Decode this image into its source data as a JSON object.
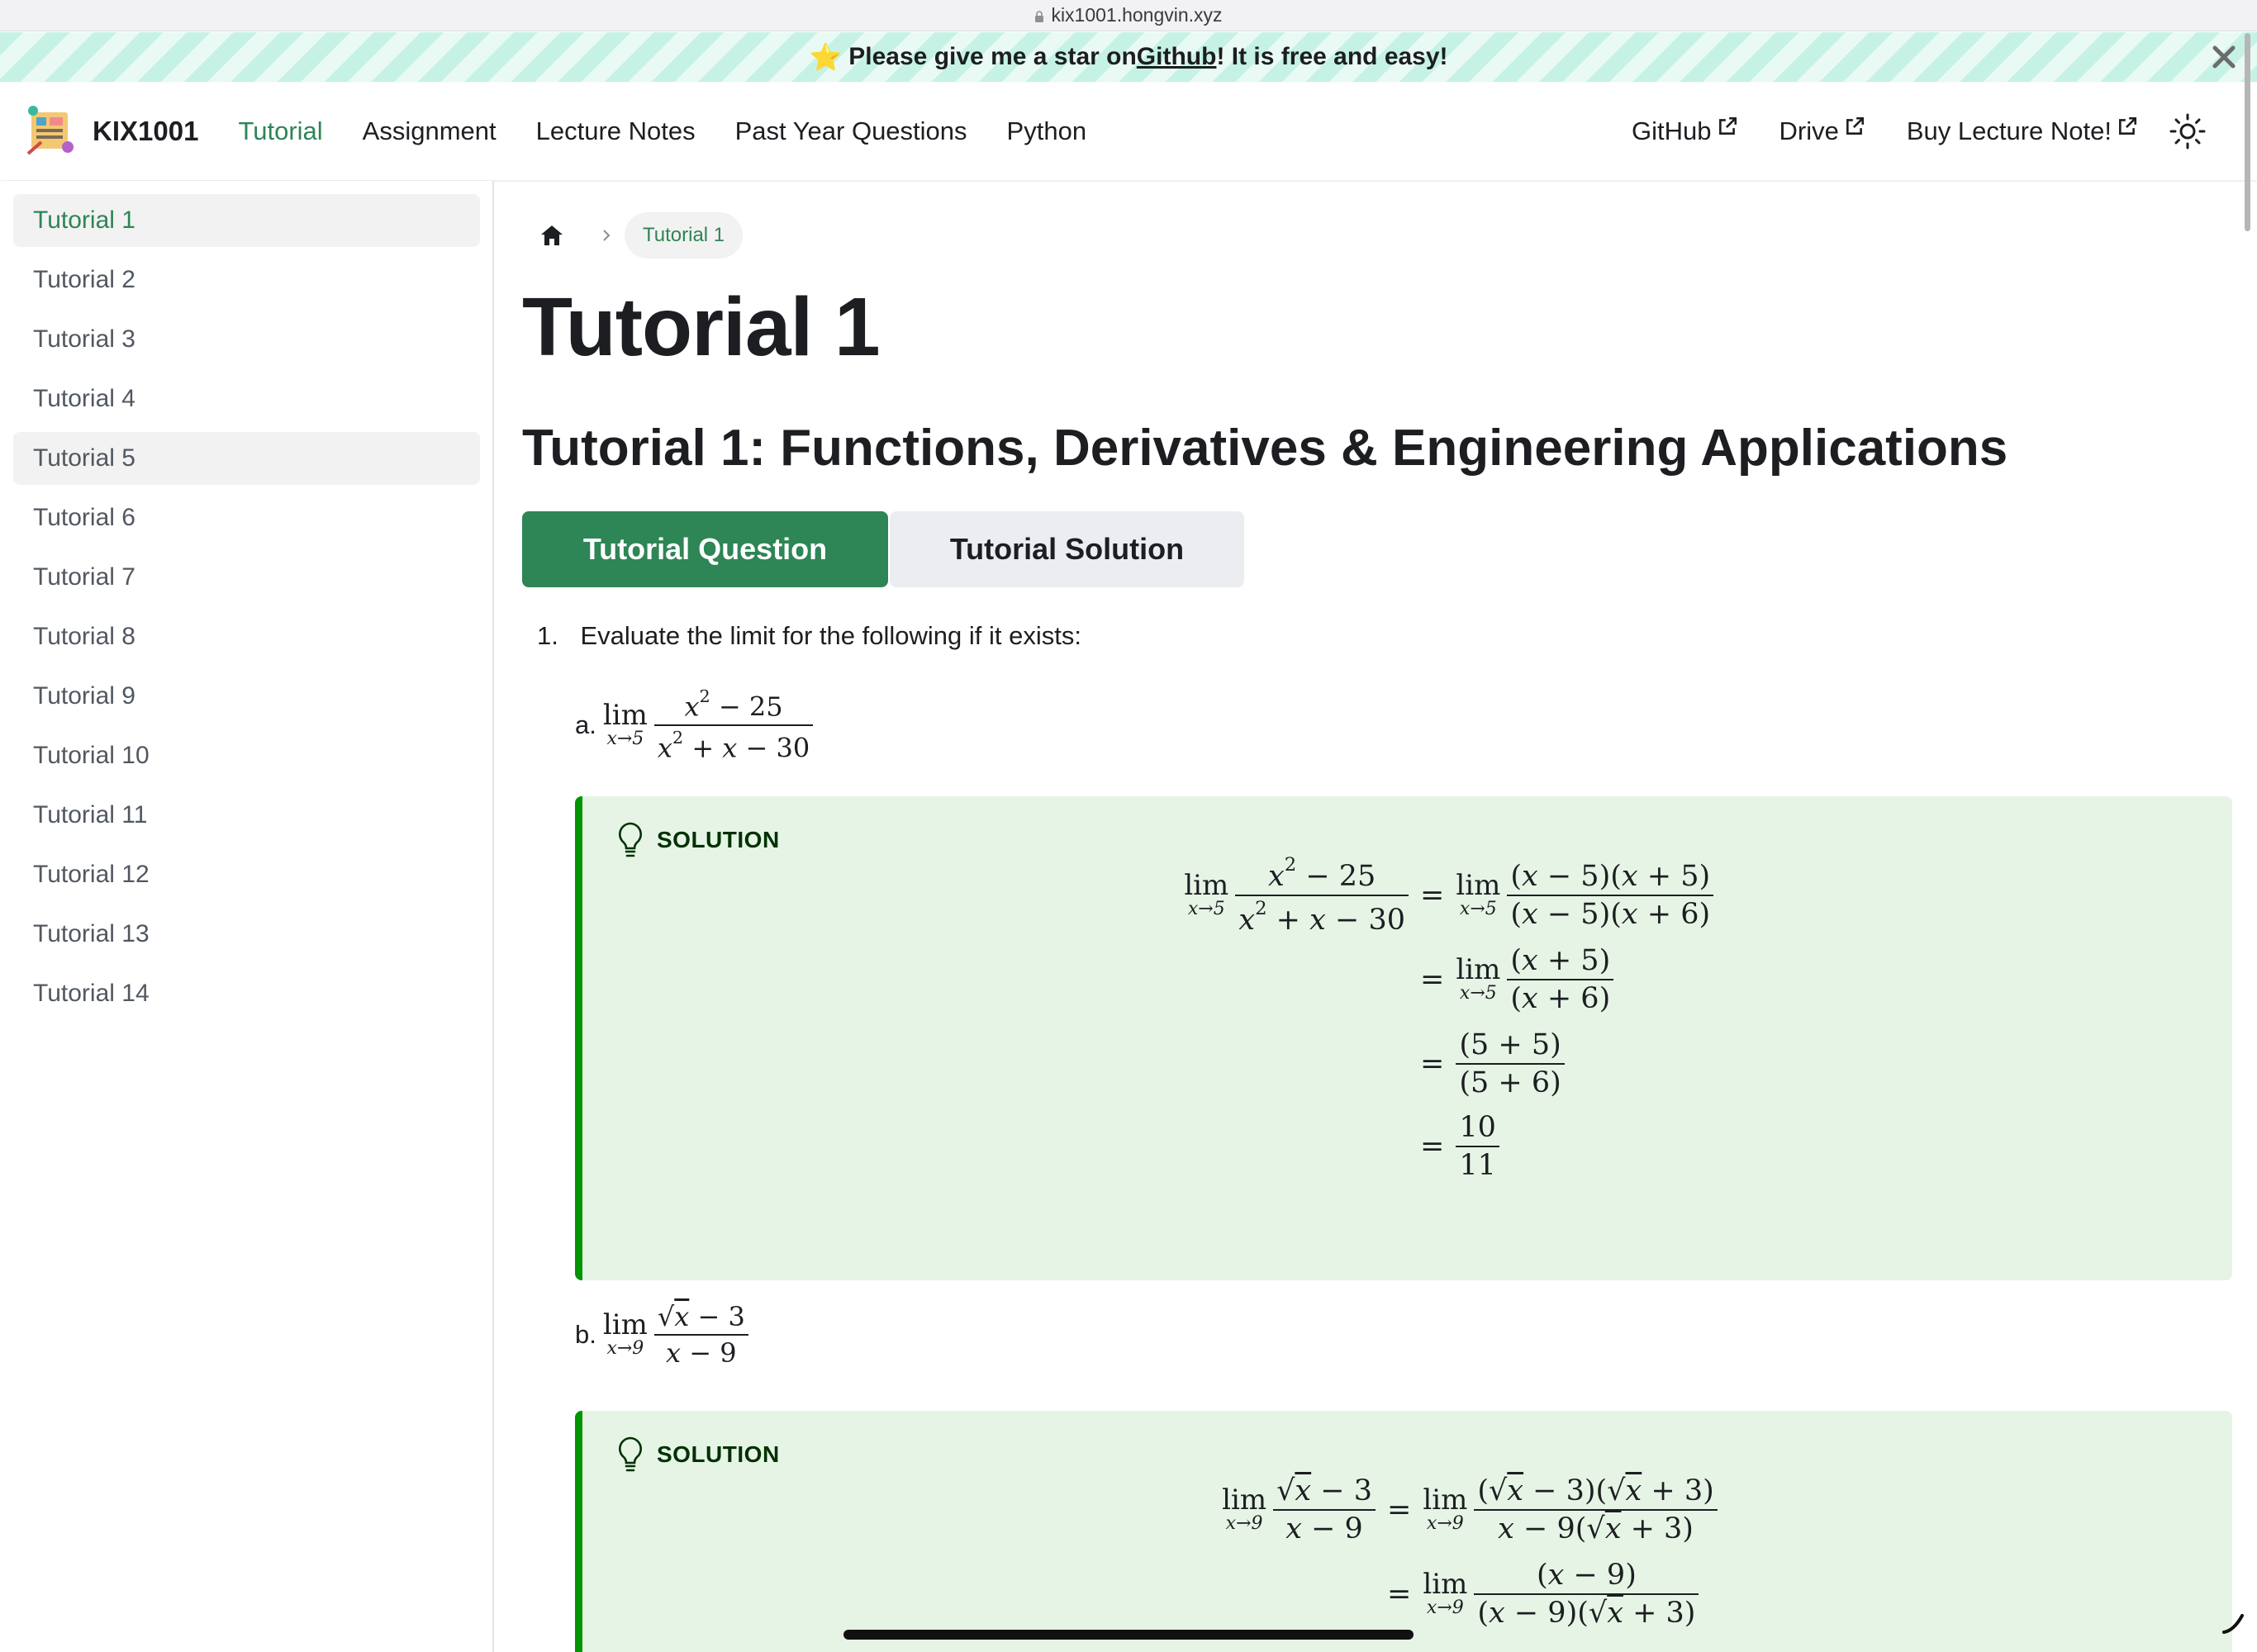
{
  "browser": {
    "url": "kix1001.hongvin.xyz"
  },
  "announcement": {
    "star": "⭐",
    "text_before": "Please give me a star on ",
    "link_text": "Github",
    "text_after": "! It is free and easy!"
  },
  "navbar": {
    "brand": "KIX1001",
    "items": [
      "Tutorial",
      "Assignment",
      "Lecture Notes",
      "Past Year Questions",
      "Python"
    ],
    "external": [
      "GitHub",
      "Drive",
      "Buy Lecture Note!"
    ]
  },
  "sidebar": {
    "items": [
      "Tutorial 1",
      "Tutorial 2",
      "Tutorial 3",
      "Tutorial 4",
      "Tutorial 5",
      "Tutorial 6",
      "Tutorial 7",
      "Tutorial 8",
      "Tutorial 9",
      "Tutorial 10",
      "Tutorial 11",
      "Tutorial 12",
      "Tutorial 13",
      "Tutorial 14"
    ],
    "active_index": 0,
    "hover_index": 4
  },
  "breadcrumb": {
    "current": "Tutorial 1"
  },
  "page": {
    "title": "Tutorial 1",
    "subtitle": "Tutorial 1: Functions, Derivatives & Engineering Applications",
    "tab_question": "Tutorial Question",
    "tab_solution": "Tutorial Solution",
    "question_number": "1.",
    "question_text": "Evaluate the limit for the following if it exists:",
    "part_a_label": "a.",
    "part_b_label": "b.",
    "solution_label": "SOLUTION"
  },
  "colors": {
    "primary": "#2e8555",
    "admonition_bg": "#e6f4e6",
    "admonition_border": "#009400"
  }
}
